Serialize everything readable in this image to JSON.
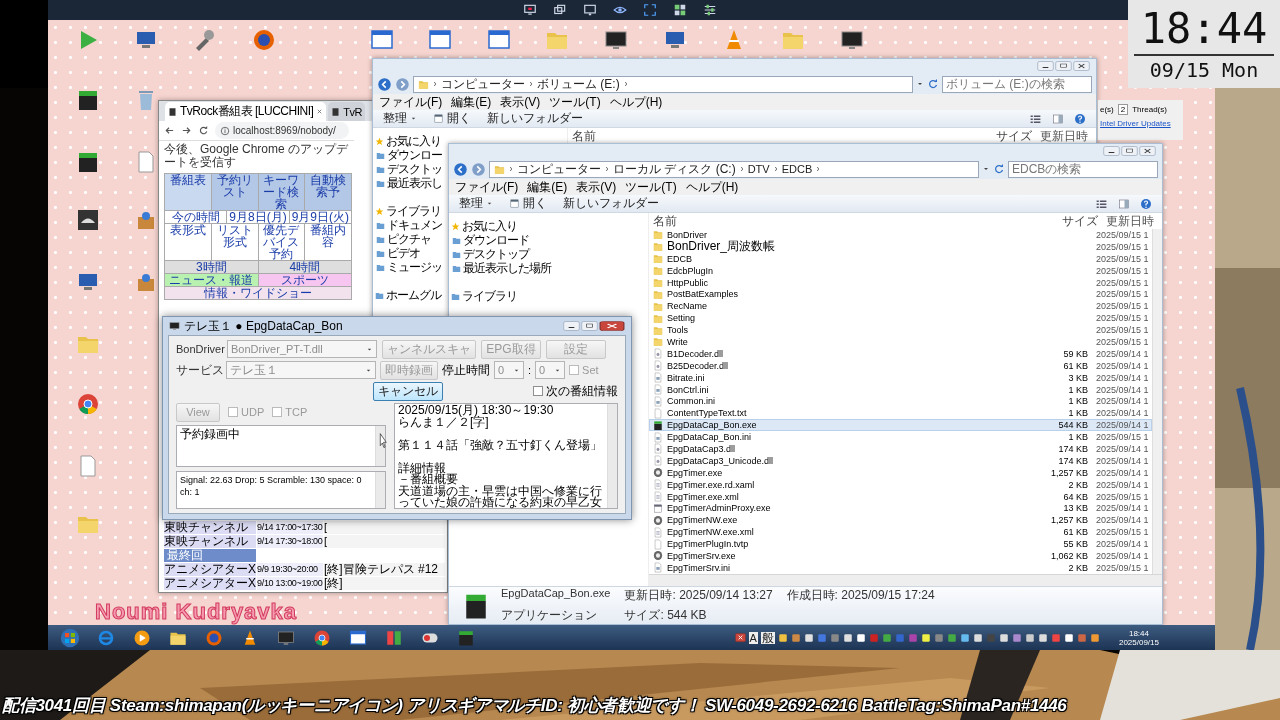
{
  "clock_overlay": {
    "time": "18:44",
    "date": "09/15 Mon"
  },
  "wallpaper_text": "Noumi Kudryavka",
  "browser": {
    "tabs": [
      {
        "label": "TvRock番組表 [LUCCHINI]",
        "selected": true
      },
      {
        "label": "TvR",
        "selected": false
      }
    ],
    "url": "localhost:8969/nobody/",
    "notice": "今後、Google Chrome のアップデートを受信す",
    "grid": [
      {
        "cells": [
          {
            "text": "番組表",
            "color": "#c9d9f0"
          },
          {
            "text": "予約リスト",
            "color": "#b3c7e6"
          },
          {
            "text": "キーワード検索",
            "color": "#b3c7e6"
          },
          {
            "text": "自動検索予",
            "color": "#b3c7e6"
          }
        ]
      },
      {
        "cells": [
          {
            "text": "今の時間",
            "color": "#ffffff"
          },
          {
            "text": "9月8日(月)",
            "color": "#ffffff"
          },
          {
            "text": "9月9日(火)",
            "color": "#ffffff"
          }
        ]
      },
      {
        "cells": [
          {
            "text": "表形式",
            "color": "#ffffff"
          },
          {
            "text": "リスト形式",
            "color": "#ffffff"
          },
          {
            "text": "優先デバイス予約",
            "color": "#ffffff"
          },
          {
            "text": "番組内容",
            "color": "#ffffff"
          }
        ]
      },
      {
        "cells": [
          {
            "text": "3時間",
            "color": "#dedede"
          },
          {
            "text": "4時間",
            "color": "#dedede"
          }
        ]
      },
      {
        "cells": [
          {
            "text": "ニュース・報道",
            "color": "#b9f2b0"
          },
          {
            "text": "スポーツ",
            "color": "#f6c6f0"
          }
        ]
      },
      {
        "cells": [
          {
            "text": "情報・ワイドショー",
            "color": "#f2e2ee"
          }
        ]
      }
    ],
    "schedule": [
      {
        "kind": "row",
        "channel": "東映チャンネル",
        "time": "9/14 17:00~17:30",
        "title": "["
      },
      {
        "kind": "row",
        "channel": "東映チャンネル",
        "time": "9/14 17:30~18:00",
        "title": "["
      },
      {
        "kind": "section",
        "label": "最終回"
      },
      {
        "kind": "row",
        "channel": "アニメシアターX",
        "time": "9/9 19:30~20:00",
        "title": "[終]冒険テレパス #12"
      },
      {
        "kind": "row",
        "channel": "アニメシアターX",
        "time": "9/10 13:00~19:00",
        "title": "[終]"
      }
    ]
  },
  "volume_window": {
    "path": [
      "コンピューター",
      "ボリューム (E:)"
    ],
    "search_placeholder": "ボリューム (E:)の検索",
    "menu": [
      "ファイル(F)",
      "編集(E)",
      "表示(V)",
      "ツール(T)",
      "ヘルプ(H)"
    ],
    "toolbar": [
      "整理",
      "開く",
      "新しいフォルダー"
    ],
    "nav": [
      {
        "label": "お気に入り",
        "children": [
          {
            "label": "ダウンロー"
          },
          {
            "label": "デスクトッ"
          },
          {
            "label": "最近表示し"
          }
        ]
      },
      {
        "label": "ライブラリ",
        "children": [
          {
            "label": "ドキュメン"
          },
          {
            "label": "ピクチャ"
          },
          {
            "label": "ビデオ"
          },
          {
            "label": "ミュージッ"
          }
        ]
      },
      {
        "label": "ホームグル"
      }
    ],
    "columns": [
      "名前",
      "サイズ",
      "更新日時"
    ]
  },
  "threads_window": {
    "cut_label": "e(s)",
    "count": "2",
    "label": "Thread(s)",
    "link": "Intel Driver Updates"
  },
  "edcb_window": {
    "path": [
      "コンピューター",
      "ローカル ディスク (C:)",
      "DTV",
      "EDCB"
    ],
    "search_placeholder": "EDCBの検索",
    "menu": [
      "ファイル(F)",
      "編集(E)",
      "表示(V)",
      "ツール(T)",
      "ヘルプ(H)"
    ],
    "toolbar": [
      "整理",
      "開く",
      "新しいフォルダー"
    ],
    "nav": [
      {
        "label": "お気に入り",
        "children": [
          {
            "label": "ダウンロード"
          },
          {
            "label": "デスクトップ"
          },
          {
            "label": "最近表示した場所"
          }
        ]
      },
      {
        "label": "ライブラリ"
      }
    ],
    "columns": [
      "名前",
      "サイズ",
      "更新日時"
    ],
    "files": [
      {
        "name": "BonDriver",
        "kind": "folder",
        "modified": "2025/09/15 1",
        "selected": false
      },
      {
        "name": "BonDriver_周波数帳",
        "kind": "folder",
        "modified": "2025/09/15 1",
        "selected": false
      },
      {
        "name": "EDCB",
        "kind": "folder",
        "modified": "2025/09/15 1",
        "selected": false
      },
      {
        "name": "EdcbPlugIn",
        "kind": "folder",
        "modified": "2025/09/15 1",
        "selected": false
      },
      {
        "name": "HttpPublic",
        "kind": "folder",
        "modified": "2025/09/15 1",
        "selected": false
      },
      {
        "name": "PostBatExamples",
        "kind": "folder",
        "modified": "2025/09/15 1",
        "selected": false
      },
      {
        "name": "RecName",
        "kind": "folder",
        "modified": "2025/09/15 1",
        "selected": false
      },
      {
        "name": "Setting",
        "kind": "folder",
        "modified": "2025/09/15 1",
        "selected": false
      },
      {
        "name": "Tools",
        "kind": "folder",
        "modified": "2025/09/15 1",
        "selected": false
      },
      {
        "name": "Write",
        "kind": "folder",
        "modified": "2025/09/15 1",
        "selected": false
      },
      {
        "name": "B1Decoder.dll",
        "kind": "dll",
        "size": "59 KB",
        "modified": "2025/09/14 1",
        "selected": false
      },
      {
        "name": "B25Decoder.dll",
        "kind": "dll",
        "size": "61 KB",
        "modified": "2025/09/14 1",
        "selected": false
      },
      {
        "name": "Bitrate.ini",
        "kind": "ini",
        "size": "3 KB",
        "modified": "2025/09/14 1",
        "selected": false
      },
      {
        "name": "BonCtrl.ini",
        "kind": "ini",
        "size": "1 KB",
        "modified": "2025/09/14 1",
        "selected": false
      },
      {
        "name": "Common.ini",
        "kind": "ini",
        "size": "1 KB",
        "modified": "2025/09/14 1",
        "selected": false
      },
      {
        "name": "ContentTypeText.txt",
        "kind": "text",
        "size": "1 KB",
        "modified": "2025/09/14 1",
        "selected": false
      },
      {
        "name": "EpgDataCap_Bon.exe",
        "kind": "app",
        "size": "544 KB",
        "modified": "2025/09/14 1",
        "selected": true
      },
      {
        "name": "EpgDataCap_Bon.ini",
        "kind": "ini",
        "size": "1 KB",
        "modified": "2025/09/15 1",
        "selected": false
      },
      {
        "name": "EpgDataCap3.dll",
        "kind": "dll",
        "size": "174 KB",
        "modified": "2025/09/14 1",
        "selected": false
      },
      {
        "name": "EpgDataCap3_Unicode.dll",
        "kind": "dll",
        "size": "174 KB",
        "modified": "2025/09/14 1",
        "selected": false
      },
      {
        "name": "EpgTimer.exe",
        "kind": "timer",
        "size": "1,257 KB",
        "modified": "2025/09/14 1",
        "selected": false
      },
      {
        "name": "EpgTimer.exe.rd.xaml",
        "kind": "xml",
        "size": "2 KB",
        "modified": "2025/09/14 1",
        "selected": false
      },
      {
        "name": "EpgTimer.exe.xml",
        "kind": "xml",
        "size": "64 KB",
        "modified": "2025/09/15 1",
        "selected": false
      },
      {
        "name": "EpgTimerAdminProxy.exe",
        "kind": "exe",
        "size": "13 KB",
        "modified": "2025/09/14 1",
        "selected": false
      },
      {
        "name": "EpgTimerNW.exe",
        "kind": "timer",
        "size": "1,257 KB",
        "modified": "2025/09/14 1",
        "selected": false
      },
      {
        "name": "EpgTimerNW.exe.xml",
        "kind": "xml",
        "size": "61 KB",
        "modified": "2025/09/15 1",
        "selected": false
      },
      {
        "name": "EpgTimerPlugIn.tvtp",
        "kind": "text",
        "size": "55 KB",
        "modified": "2025/09/14 1",
        "selected": false
      },
      {
        "name": "EpgTimerSrv.exe",
        "kind": "timer",
        "size": "1,062 KB",
        "modified": "2025/09/14 1",
        "selected": false
      },
      {
        "name": "EpgTimerSrv.ini",
        "kind": "ini",
        "size": "2 KB",
        "modified": "2025/09/15 1",
        "selected": false
      }
    ],
    "details": {
      "name": "EpgDataCap_Bon.exe",
      "modified": "更新日時: 2025/09/14 13:27",
      "created": "作成日時: 2025/09/15 17:24",
      "type": "アプリケーション",
      "size": "サイズ: 544 KB"
    }
  },
  "epg_window": {
    "title": "テレ玉１ ● EpgDataCap_Bon",
    "bondriver_label": "BonDriver",
    "bondriver": {
      "value": "BonDriver_PT-T.dll",
      "disabled": true
    },
    "scan_button": {
      "label": "ャンネルスキャ",
      "disabled": true
    },
    "epg_button": {
      "label": "EPG取得",
      "disabled": true
    },
    "settings_button": {
      "label": "設定",
      "disabled": true
    },
    "service_label": "サービス",
    "service": {
      "value": "テレ玉１",
      "disabled": true
    },
    "record_button": {
      "label": "即時録画",
      "disabled": true
    },
    "stop_label": "停止時間",
    "stop_hour": {
      "value": "0",
      "disabled": true
    },
    "separator": ":",
    "stop_minute": {
      "value": "0",
      "disabled": true
    },
    "set_checkbox": {
      "label": "Set",
      "checked": false,
      "disabled": true
    },
    "cancel_button": {
      "label": "キャンセル",
      "disabled": false
    },
    "next_checkbox": {
      "label": "次の番組情報",
      "checked": false,
      "disabled": false
    },
    "view_button": {
      "label": "View",
      "disabled": true
    },
    "udp_checkbox": {
      "label": "UDP",
      "checked": false,
      "disabled": true
    },
    "tcp_checkbox": {
      "label": "TCP",
      "checked": false,
      "disabled": true
    },
    "status": "予約録画中",
    "signal": "Signal: 22.63 Drop: 5 Scramble: 130  space: 0 ch: 1",
    "program_info": [
      [
        "2025/09/15(月) 18:30～19:30",
        "らんま１／２[字]"
      ],
      [
        "第１１４話「強敵？五寸釘くん登場」"
      ],
      [
        "詳細情報",
        "－番組概要",
        "天道道場の主・早雲は中国へ修業に行っていた娘の許婚になる約束の早乙女"
      ]
    ]
  },
  "taskbar": {
    "ime": [
      "A",
      "般"
    ],
    "time": "18:44",
    "date": "2025/09/15"
  },
  "ticker": "配信3041回目 Steam:shimapan(ルッキーニアイコン) アリスギアマルチID: 初心者歓迎です！ SW-6049-2692-6216 BattleTag:ShimaPan#1446"
}
